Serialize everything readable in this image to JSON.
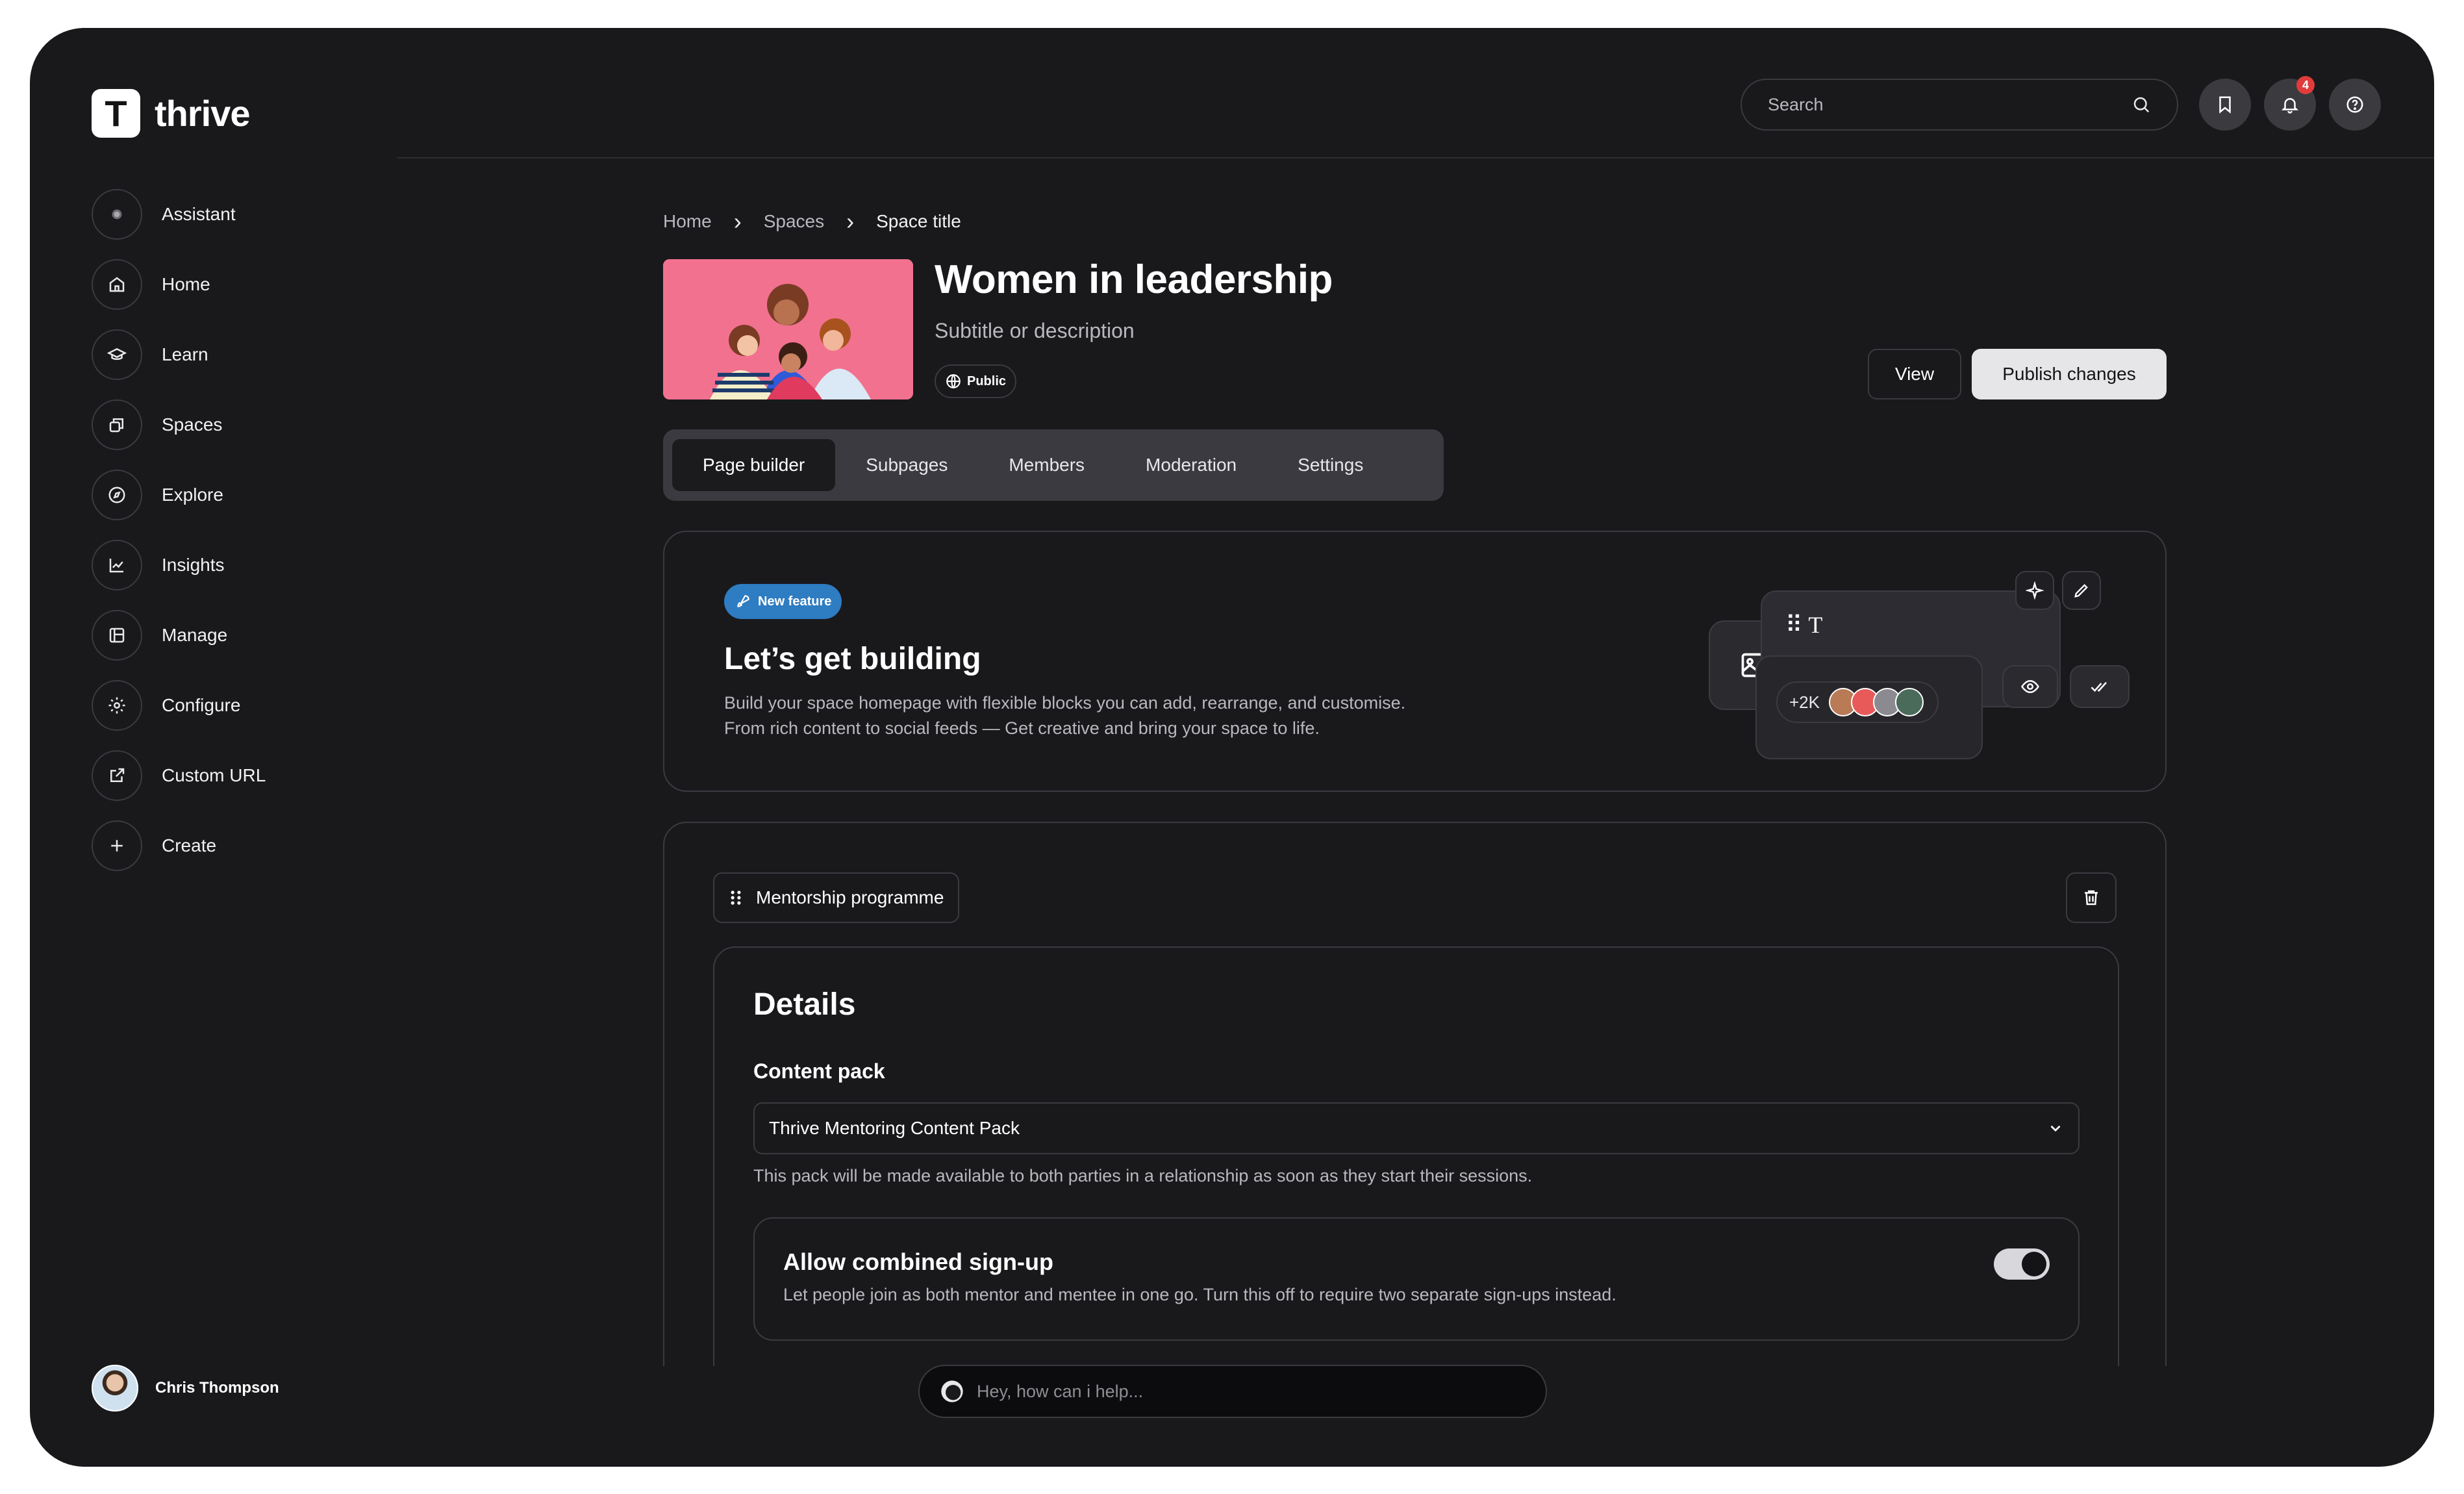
{
  "app": {
    "name": "thrive",
    "logo_letter": "T"
  },
  "sidebar": {
    "items": [
      {
        "label": "Assistant",
        "icon": "assistant-orb-icon"
      },
      {
        "label": "Home",
        "icon": "home-icon"
      },
      {
        "label": "Learn",
        "icon": "graduation-cap-icon"
      },
      {
        "label": "Spaces",
        "icon": "spaces-icon"
      },
      {
        "label": "Explore",
        "icon": "compass-icon"
      },
      {
        "label": "Insights",
        "icon": "line-chart-icon"
      },
      {
        "label": "Manage",
        "icon": "manage-icon"
      },
      {
        "label": "Configure",
        "icon": "gear-icon"
      },
      {
        "label": "Custom URL",
        "icon": "external-link-icon"
      },
      {
        "label": "Create",
        "icon": "plus-icon"
      }
    ],
    "user": {
      "name": "Chris Thompson"
    }
  },
  "header": {
    "search_placeholder": "Search",
    "notifications_count": "4"
  },
  "breadcrumb": [
    "Home",
    "Spaces",
    "Space title"
  ],
  "space": {
    "title": "Women in leadership",
    "subtitle": "Subtitle or description",
    "visibility": "Public",
    "view_label": "View",
    "publish_label": "Publish changes"
  },
  "tabs": [
    "Page builder",
    "Subpages",
    "Members",
    "Moderation",
    "Settings"
  ],
  "feature": {
    "badge": "New feature",
    "title": "Let’s get building",
    "desc_line1": "Build your space homepage with flexible blocks you can add, rearrange, and customise.",
    "desc_line2": "From rich content to social feeds — Get creative and bring your space to life.",
    "illustration_count": "+2K"
  },
  "block": {
    "name": "Mentorship programme",
    "details_heading": "Details",
    "content_pack_label": "Content pack",
    "content_pack_value": "Thrive Mentoring Content Pack",
    "content_pack_help": "This pack will be made available to both parties in a relationship as soon as they start their sessions.",
    "combined_title": "Allow combined sign-up",
    "combined_desc": "Let people join as both mentor and mentee in one go. Turn this off to require two separate sign-ups instead.",
    "combined_enabled": true
  },
  "assistant": {
    "placeholder": "Hey, how can i help..."
  },
  "colors": {
    "background": "#19191c",
    "accent": "#2e7cc2",
    "cover": "#f2718f",
    "badge": "#e23b3b"
  }
}
